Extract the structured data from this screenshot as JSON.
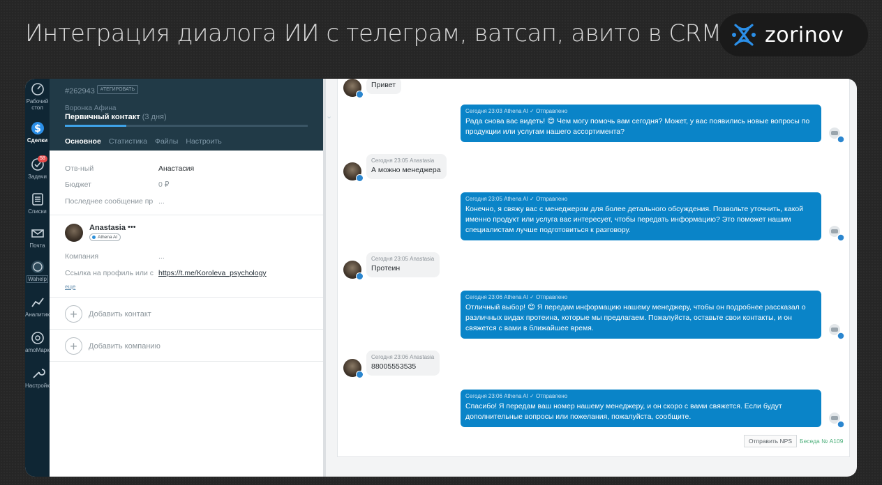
{
  "headline": "Интеграция диалога ИИ с телеграм, ватсап, авито в CRM",
  "brand": {
    "name": "zorinov",
    "icon": "dna-icon",
    "color": "#2b8fe8"
  },
  "nav": {
    "items": [
      {
        "label": "Рабочий стол",
        "icon": "dashboard-icon"
      },
      {
        "label": "Сделки",
        "icon": "deals-icon"
      },
      {
        "label": "Задачи",
        "icon": "tasks-icon",
        "badge": "58"
      },
      {
        "label": "Списки",
        "icon": "lists-icon"
      },
      {
        "label": "Почта",
        "icon": "mail-icon"
      },
      {
        "label": "Wahelp",
        "icon": "whatsapp-icon"
      },
      {
        "label": "Аналитика",
        "icon": "analytics-icon"
      },
      {
        "label": "amoМаркет",
        "icon": "market-icon"
      },
      {
        "label": "Настройки",
        "icon": "settings-icon"
      }
    ]
  },
  "lead": {
    "id": "#262943",
    "tag_button": "#ТЕГИРОВАТЬ",
    "pipeline": "Воронка Афина",
    "stage": "Первичный контакт",
    "stage_days": "(3 дня)",
    "tabs": [
      "Основное",
      "Статистика",
      "Файлы",
      "Настроить"
    ],
    "fields": [
      {
        "label": "Отв-ный",
        "value": "Анастасия"
      },
      {
        "label": "Бюджет",
        "value": "0 ₽"
      },
      {
        "label": "Последнее сообщение пр",
        "value": "..."
      }
    ],
    "contact": {
      "name": "Anastasia",
      "dots": "•••",
      "tag": "Athena AI",
      "company_label": "Компания",
      "company_value": "...",
      "link_label": "Ссылка на профиль или с",
      "link_value": "https://t.me/Koroleva_psychology",
      "more": "еще"
    },
    "add_contact": "Добавить контакт",
    "add_company": "Добавить компанию"
  },
  "chat": {
    "incoming": [
      {
        "meta": "",
        "text": "Привет"
      },
      {
        "meta": "Сегодня 23:05 Anastasia",
        "text": "А можно менеджера"
      },
      {
        "meta": "Сегодня 23:05 Anastasia",
        "text": "Протеин"
      },
      {
        "meta": "Сегодня 23:06 Anastasia",
        "text": "88005553535"
      }
    ],
    "outgoing": [
      {
        "meta": "Сегодня 23:03 Athena AI ✓ Отправлено",
        "text": "Рада снова вас видеть! 😊 Чем могу помочь вам сегодня? Может, у вас появились новые вопросы по продукции или услугам нашего ассортимента?"
      },
      {
        "meta": "Сегодня 23:05 Athena AI ✓ Отправлено",
        "text": "Конечно, я свяжу вас с менеджером для более детального обсуждения. Позвольте уточнить, какой именно продукт или услуга вас интересует, чтобы передать информацию? Это поможет нашим специалистам лучше подготовиться к разговору."
      },
      {
        "meta": "Сегодня 23:06 Athena AI ✓ Отправлено",
        "text": "Отличный выбор! 😊 Я передам информацию нашему менеджеру, чтобы он подробнее рассказал о различных видах протеина, которые мы предлагаем. Пожалуйста, оставьте свои контакты, и он свяжется с вами в ближайшее время."
      },
      {
        "meta": "Сегодня 23:06 Athena AI ✓ Отправлено",
        "text": "Спасибо! Я передам ваш номер нашему менеджеру, и он скоро с вами свяжется. Если будут дополнительные вопросы или пожелания, пожалуйста, сообщите."
      }
    ],
    "nps_button": "Отправить NPS",
    "conversation": "Беседа № A109"
  }
}
